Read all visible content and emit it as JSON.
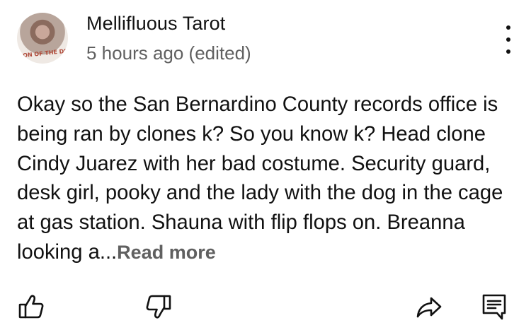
{
  "comment": {
    "author": "Mellifluous Tarot",
    "timestamp": "5 hours ago (edited)",
    "avatar_shirt_text": "ON OF THE DESER",
    "text": "Okay so the San Bernardino County records office is being ran by clones k? So you know k? Head clone Cindy Juarez with her bad costume. Security guard, desk girl, pooky and the lady with the dog in the cage at gas station. Shauna with flip flops on. Breanna looking a",
    "ellipsis": "...",
    "read_more": "Read more"
  },
  "actions": {
    "like_icon": "thumbs-up-icon",
    "dislike_icon": "thumbs-down-icon",
    "share_icon": "share-icon",
    "reply_icon": "reply-icon",
    "menu_icon": "more-vert-icon"
  }
}
